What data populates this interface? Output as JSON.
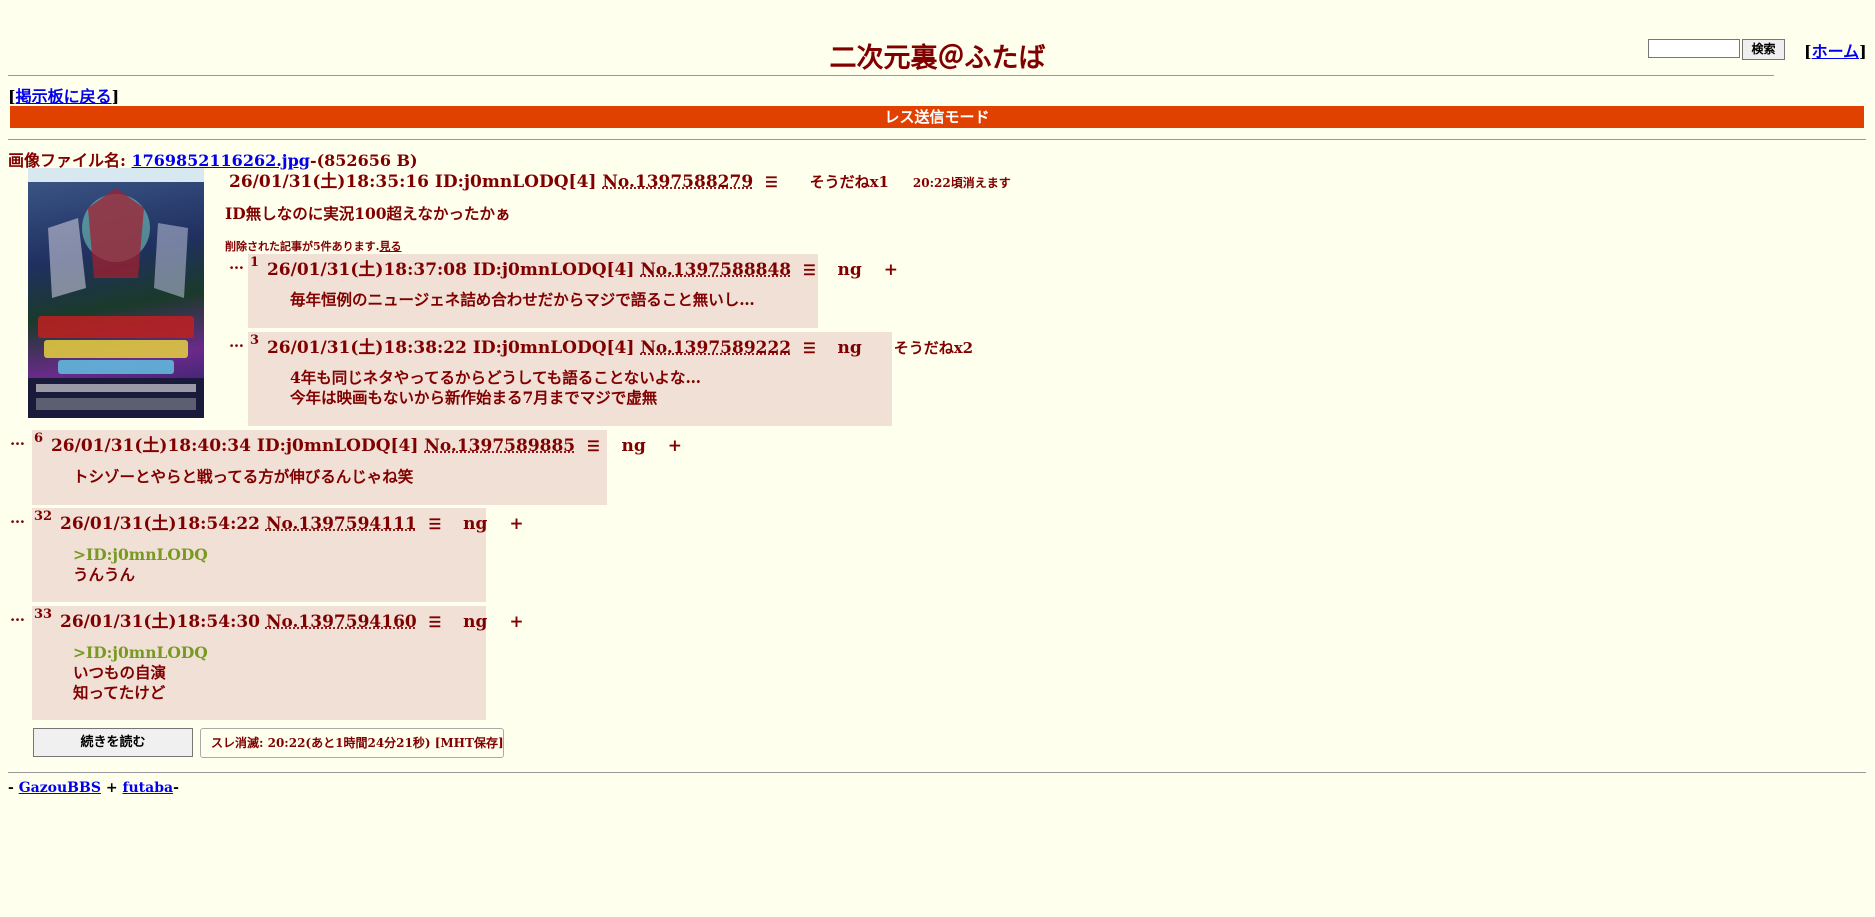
{
  "header": {
    "title": "二次元裏＠ふたば",
    "search_button": "検索",
    "home_open": "[",
    "home_label": "ホーム",
    "home_close": "]",
    "back_open": "[",
    "back_label": "掲示板に戻る",
    "back_close": "]",
    "mode_label": "レス送信モード"
  },
  "op": {
    "file_prefix": "画像ファイル名: ",
    "file_name": "1769852116262.jpg",
    "file_suffix": "-(852656 B)",
    "datetime": "26/01/31(土)18:35:16",
    "id": "ID:j0mnLODQ[4]",
    "no": "No.1397588279",
    "menu": "☰",
    "soudane": "そうだねx1",
    "expire": "20:22頃消えます",
    "body": "ID無しなのに実況100超えなかったかぁ",
    "deleted_note": "削除された記事が5件あります.",
    "deleted_link": "見る"
  },
  "replies": [
    {
      "dots": "…",
      "num": "1",
      "datetime": "26/01/31(土)18:37:08",
      "id": "ID:j0mnLODQ[4]",
      "no": "No.1397588848",
      "menu": "☰",
      "ng": "ng",
      "plus": "+",
      "soudane": "",
      "lines": [
        "毎年恒例のニュージェネ詰め合わせだからマジで語ること無いし…"
      ]
    },
    {
      "dots": "…",
      "num": "3",
      "datetime": "26/01/31(土)18:38:22",
      "id": "ID:j0mnLODQ[4]",
      "no": "No.1397589222",
      "menu": "☰",
      "ng": "ng",
      "plus": "",
      "soudane": "そうだねx2",
      "lines": [
        "4年も同じネタやってるからどうしても語ることないよな…",
        "今年は映画もないから新作始まる7月までマジで虚無"
      ]
    },
    {
      "dots": "…",
      "num": "6",
      "datetime": "26/01/31(土)18:40:34",
      "id": "ID:j0mnLODQ[4]",
      "no": "No.1397589885",
      "menu": "☰",
      "ng": "ng",
      "plus": "+",
      "soudane": "",
      "lines": [
        "トシゾーとやらと戦ってる方が伸びるんじゃね笑"
      ]
    },
    {
      "dots": "…",
      "num": "32",
      "datetime": "26/01/31(土)18:54:22",
      "id": "",
      "no": "No.1397594111",
      "menu": "☰",
      "ng": "ng",
      "plus": "+",
      "soudane": "",
      "quote": ">ID:j0mnLODQ",
      "lines": [
        "うんうん"
      ]
    },
    {
      "dots": "…",
      "num": "33",
      "datetime": "26/01/31(土)18:54:30",
      "id": "",
      "no": "No.1397594160",
      "menu": "☰",
      "ng": "ng",
      "plus": "+",
      "soudane": "",
      "quote": ">ID:j0mnLODQ",
      "lines": [
        "いつもの自演",
        "知ってたけど"
      ]
    }
  ],
  "footer": {
    "read_more": "続きを読む",
    "expire_info": "スレ消滅: 20:22(あと1時間24分21秒) [MHT保存]",
    "credit_prefix": "- ",
    "gazou": "GazouBBS",
    "plus": " + ",
    "futaba": "futaba",
    "credit_suffix": "-"
  }
}
